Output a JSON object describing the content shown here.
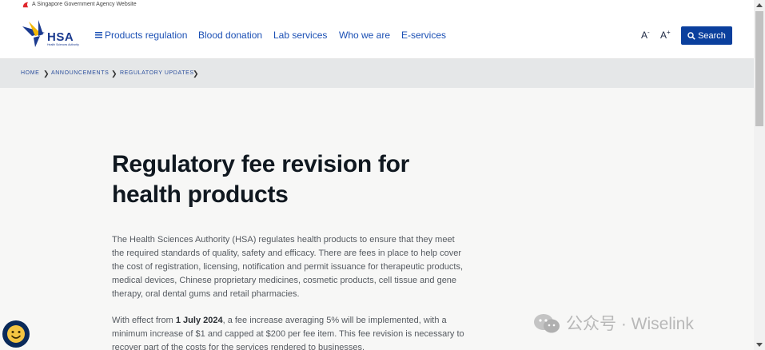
{
  "masthead": {
    "text": "A Singapore Government Agency Website"
  },
  "logo": {
    "brand": "HSA",
    "subtitle": "Health Sciences Authority"
  },
  "nav": {
    "items": [
      {
        "label": "Products regulation"
      },
      {
        "label": "Blood donation"
      },
      {
        "label": "Lab services"
      },
      {
        "label": "Who we are"
      },
      {
        "label": "E-services"
      }
    ],
    "font_decrease": "A",
    "font_decrease_mark": "-",
    "font_increase": "A",
    "font_increase_mark": "+",
    "search_label": "Search"
  },
  "breadcrumb": {
    "items": [
      {
        "label": "HOME"
      },
      {
        "label": "ANNOUNCEMENTS"
      },
      {
        "label": "REGULATORY UPDATES"
      }
    ]
  },
  "article": {
    "title": "Regulatory fee revision for health products",
    "paragraph1": "The Health Sciences Authority (HSA) regulates health products to ensure that they meet the required standards of quality, safety and efficacy. There are fees in place to help cover the cost of registration, licensing, notification and permit issuance for therapeutic products, medical devices, Chinese proprietary medicines, cosmetic products, cell tissue and gene therapy, oral dental gums and retail pharmacies.",
    "paragraph2_pre": "With effect from ",
    "paragraph2_bold": "1 July 2024",
    "paragraph2_post": ", a fee increase averaging 5% will be implemented, with a minimum increase of $1 and capped at $200 per fee item. This fee revision is necessary to recover part of the costs for the services rendered to businesses."
  },
  "watermark": {
    "text": "公众号 · Wiselink"
  },
  "colors": {
    "primary": "#0a3f9d",
    "link": "#1a4fb4",
    "breadcrumb_bg": "#e5e7e8"
  }
}
